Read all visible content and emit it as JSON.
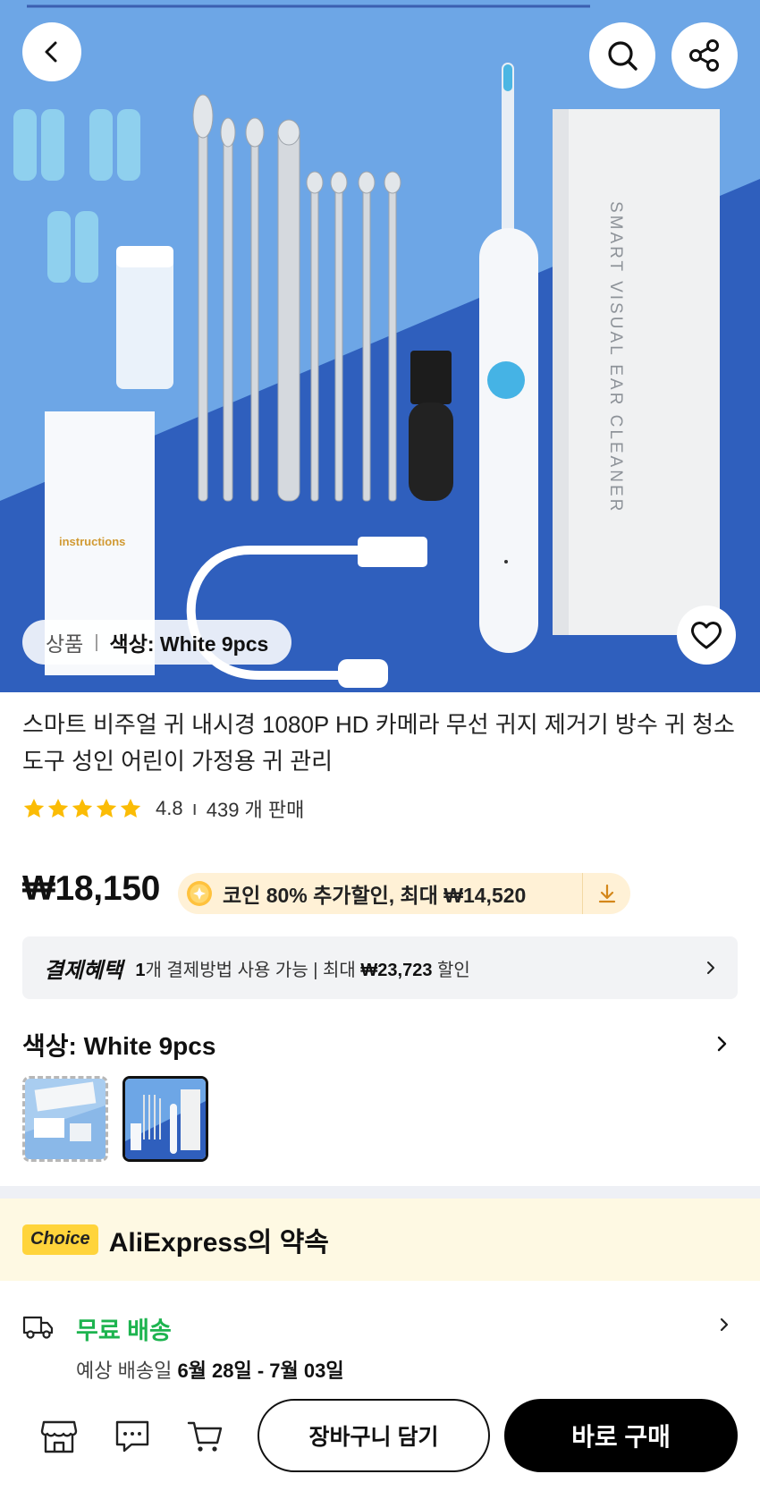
{
  "colors": {
    "accent": "#000000",
    "free_shipping": "#1db44f",
    "choice_badge": "#ffd43b",
    "coin_badge_bg": "#fff1d6",
    "hero_light_blue": "#6da6e6",
    "hero_dark_blue": "#2f5fbd"
  },
  "icons": {
    "back": "chevron-left-icon",
    "search": "search-icon",
    "share": "share-icon",
    "favorite": "heart-icon",
    "store": "store-icon",
    "chat": "chat-icon",
    "cart": "cart-icon"
  },
  "hero": {
    "variant_prefix": "상품",
    "variant_selected": "색상: White 9pcs",
    "box_text": "SMART VISUAL EAR CLEANER",
    "instructions_text": "instructions"
  },
  "product": {
    "title": "스마트 비주얼 귀 내시경 1080P HD 카메라 무선 귀지 제거기 방수 귀 청소 도구 성인 어린이 가정용 귀 관리",
    "rating": "4.8",
    "rating_stars": 5,
    "sold": "439 개 판매"
  },
  "price": {
    "current": "₩18,150",
    "coin_offer": "코인 80% 추가할인, 최대 ₩14,520"
  },
  "payment": {
    "brand": "결제혜택",
    "count": "1",
    "text_mid": "개 결제방법 사용 가능 | 최대 ",
    "max_discount": "₩23,723",
    "text_end": " 할인"
  },
  "color_select": {
    "label": "색상: White 9pcs"
  },
  "choice": {
    "badge": "Choice",
    "title": "AliExpress의 약속"
  },
  "shipping": {
    "title": "무료 배송",
    "date_prefix": "예상 배송일 ",
    "date_range": "6월 28일 - 7월 03일"
  },
  "bottom": {
    "add_to_cart": "장바구니 담기",
    "buy_now": "바로 구매"
  }
}
